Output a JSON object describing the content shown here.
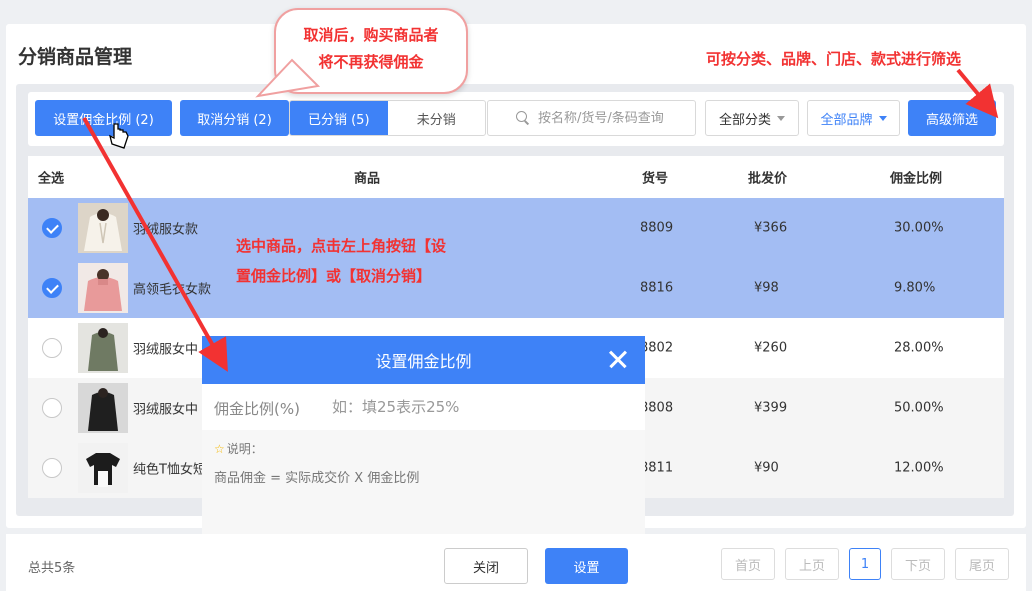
{
  "page": {
    "title": "分销商品管理"
  },
  "toolbar": {
    "set_ratio_label": "设置佣金比例 (2)",
    "cancel_label": "取消分销 (2)",
    "tab_distributed": "已分销 (5)",
    "tab_undistributed": "未分销",
    "search_placeholder": "按名称/货号/条码查询",
    "category_label": "全部分类",
    "brand_label": "全部品牌",
    "advanced_filter_label": "高级筛选"
  },
  "table": {
    "headers": {
      "select_all": "全选",
      "product": "商品",
      "code": "货号",
      "price": "批发价",
      "ratio": "佣金比例"
    },
    "rows": [
      {
        "selected": true,
        "name": "羽绒服女款",
        "code": "8809",
        "price": "¥366",
        "ratio": "30.00%"
      },
      {
        "selected": true,
        "name": "高领毛衣女款",
        "code": "8816",
        "price": "¥98",
        "ratio": "9.80%"
      },
      {
        "selected": false,
        "name": "羽绒服女中",
        "code": "8802",
        "price": "¥260",
        "ratio": "28.00%"
      },
      {
        "selected": false,
        "name": "羽绒服女中",
        "code": "8808",
        "price": "¥399",
        "ratio": "50.00%"
      },
      {
        "selected": false,
        "name": "纯色T恤女短",
        "code": "8811",
        "price": "¥90",
        "ratio": "12.00%"
      }
    ]
  },
  "modal": {
    "title": "设置佣金比例",
    "field_label": "佣金比例(%)",
    "field_placeholder": "如：填25表示25%",
    "note_title": "说明：",
    "note_formula": "商品佣金 = 实际成交价 X 佣金比例"
  },
  "footer": {
    "total": "总共5条",
    "close_label": "关闭",
    "set_label": "设置",
    "pagination": {
      "first": "首页",
      "prev": "上页",
      "current": "1",
      "next": "下页",
      "last": "尾页"
    }
  },
  "annotations": {
    "bubble_line1": "取消后，购买商品者",
    "bubble_line2": "将不再获得佣金",
    "filter_note": "可按分类、品牌、门店、款式进行筛选",
    "select_note_line1": "选中商品，点击左上角按钮【设",
    "select_note_line2": "置佣金比例】或【取消分销】"
  },
  "colors": {
    "accent": "#3e82f7",
    "selected_row": "#a3bdf3",
    "annotation": "#f23232"
  }
}
